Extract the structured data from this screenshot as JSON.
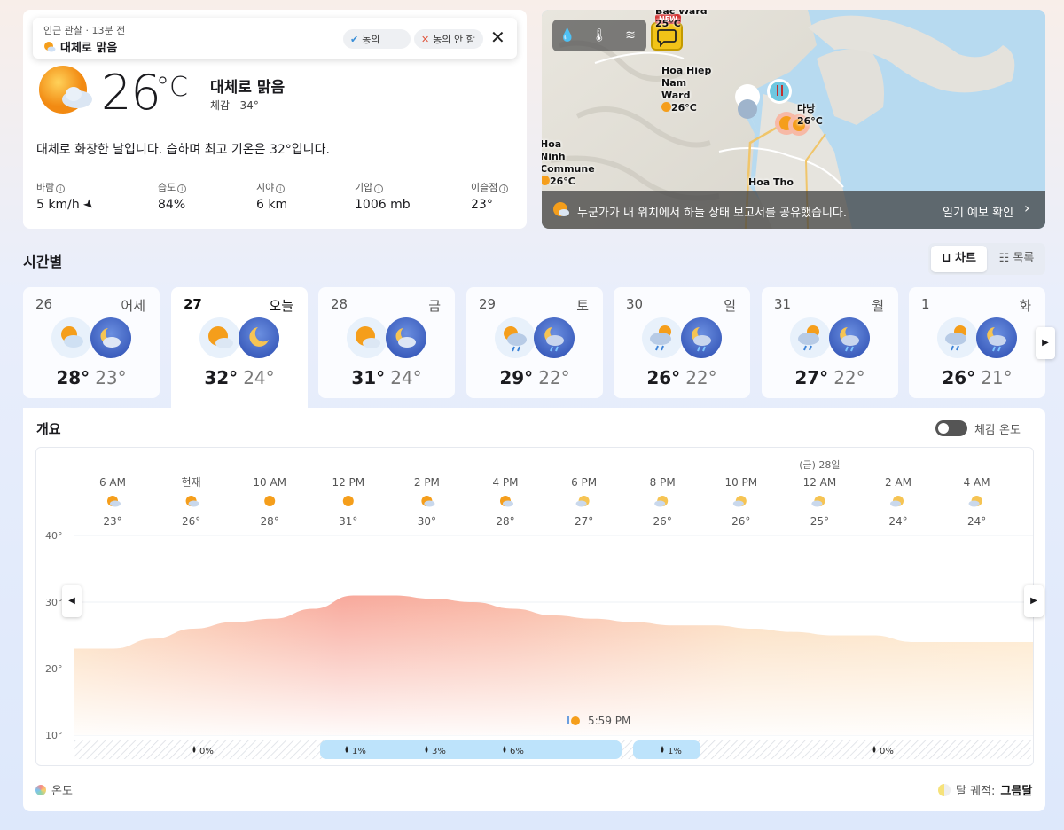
{
  "current": {
    "report_time": "인근 관찰 · 13분 전",
    "report_condition": "대체로 맑음",
    "agree_label": "동의",
    "disagree_label": "동의 안 함",
    "temperature": "26",
    "unit": "°C",
    "condition": "대체로 맑음",
    "feels_like_label": "체감",
    "feels_like_value": "34°",
    "description": "대체로 화창한 날입니다. 습하며 최고 기온은 32°입니다.",
    "stats": [
      {
        "label": "바람",
        "value": "5 km/h"
      },
      {
        "label": "습도",
        "value": "84%"
      },
      {
        "label": "시야",
        "value": "6 km"
      },
      {
        "label": "기압",
        "value": "1006 mb"
      },
      {
        "label": "이슬점",
        "value": "23°"
      }
    ]
  },
  "map": {
    "new_badge": "NEW",
    "labels": [
      {
        "name": "Bac Ward",
        "temp": "25°C"
      },
      {
        "name": "Hoa Hiep Nam Ward",
        "temp": "26°C"
      },
      {
        "name": "다낭",
        "temp": "26°C"
      },
      {
        "name": "Hoa Ninh Commune",
        "temp": "26°C"
      },
      {
        "name": "Hoa Tho",
        "temp": ""
      }
    ],
    "footer_message": "누군가가 내 위치에서 하늘 상태 보고서를 공유했습니다.",
    "footer_link": "일기 예보 확인"
  },
  "hourly": {
    "title": "시간별",
    "chart_toggle": "차트",
    "list_toggle": "목록"
  },
  "days": [
    {
      "num": "26",
      "name": "어제",
      "hi": "28°",
      "lo": "23°",
      "day_icon": "partly-cloudy-day-icon",
      "night_icon": "partly-cloudy-night-icon"
    },
    {
      "num": "27",
      "name": "오늘",
      "hi": "32°",
      "lo": "24°",
      "day_icon": "mostly-sunny-icon",
      "night_icon": "clear-night-icon"
    },
    {
      "num": "28",
      "name": "금",
      "hi": "31°",
      "lo": "24°",
      "day_icon": "mostly-sunny-icon",
      "night_icon": "partly-cloudy-night-icon"
    },
    {
      "num": "29",
      "name": "토",
      "hi": "29°",
      "lo": "22°",
      "day_icon": "sun-shower-icon",
      "night_icon": "night-shower-icon"
    },
    {
      "num": "30",
      "name": "일",
      "hi": "26°",
      "lo": "22°",
      "day_icon": "rain-icon",
      "night_icon": "night-shower-icon"
    },
    {
      "num": "31",
      "name": "월",
      "hi": "27°",
      "lo": "22°",
      "day_icon": "rain-icon",
      "night_icon": "night-shower-icon"
    },
    {
      "num": "1",
      "name": "화",
      "hi": "26°",
      "lo": "21°",
      "day_icon": "rain-icon",
      "night_icon": "night-shower-icon"
    }
  ],
  "overview": {
    "title": "개요",
    "feels_toggle": "체감 온도",
    "legend": "온도",
    "moon_label": "달 궤적:",
    "moon_value": "그믐달",
    "sunset": "5:59 PM",
    "date_marker": "(금) 28일"
  },
  "chart_data": {
    "type": "area",
    "title": "",
    "xlabel": "",
    "ylabel": "",
    "ylim": [
      10,
      40
    ],
    "yticks": [
      "40°",
      "30°",
      "20°",
      "10°"
    ],
    "hours": [
      "6 AM",
      "현재",
      "10 AM",
      "12 PM",
      "2 PM",
      "4 PM",
      "6 PM",
      "8 PM",
      "10 PM",
      "12 AM",
      "2 AM",
      "4 AM"
    ],
    "hour_temps": [
      "23°",
      "26°",
      "28°",
      "31°",
      "30°",
      "28°",
      "27°",
      "26°",
      "26°",
      "25°",
      "24°",
      "24°"
    ],
    "x": [
      "5 AM",
      "6 AM",
      "7 AM",
      "8 AM",
      "9 AM",
      "10 AM",
      "11 AM",
      "12 PM",
      "1 PM",
      "2 PM",
      "3 PM",
      "4 PM",
      "5 PM",
      "6 PM",
      "7 PM",
      "8 PM",
      "9 PM",
      "10 PM",
      "11 PM",
      "12 AM",
      "1 AM",
      "2 AM",
      "3 AM",
      "4 AM",
      "5 AM"
    ],
    "y": [
      23,
      23,
      24.5,
      26,
      27,
      27.5,
      29,
      31,
      31,
      30.5,
      30,
      29,
      28,
      27.5,
      27,
      26.5,
      26.5,
      26,
      25.5,
      25,
      25,
      24,
      24,
      24,
      24
    ],
    "precip": [
      "0%",
      "1%",
      "3%",
      "6%",
      "1%",
      "0%"
    ],
    "colors": {
      "warm": "#f7a8a0",
      "mild": "#fbe1c4",
      "rain": "#bde3fb"
    }
  }
}
